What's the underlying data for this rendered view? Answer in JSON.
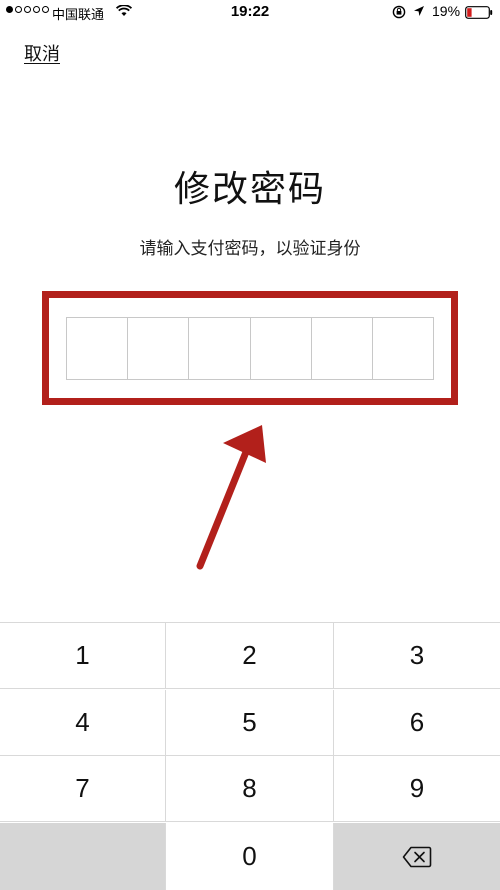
{
  "status_bar": {
    "carrier": "中国联通",
    "time": "19:22",
    "battery": "19%",
    "signal_strength": 1,
    "signal_total": 5
  },
  "header": {
    "cancel_label": "取消"
  },
  "main": {
    "title": "修改密码",
    "subtitle": "请输入支付密码，以验证身份",
    "pin_length": 6,
    "highlight_color": "#b2201b"
  },
  "keypad": {
    "keys": [
      "1",
      "2",
      "3",
      "4",
      "5",
      "6",
      "7",
      "8",
      "9",
      "0"
    ],
    "delete_icon": "backspace-icon"
  }
}
